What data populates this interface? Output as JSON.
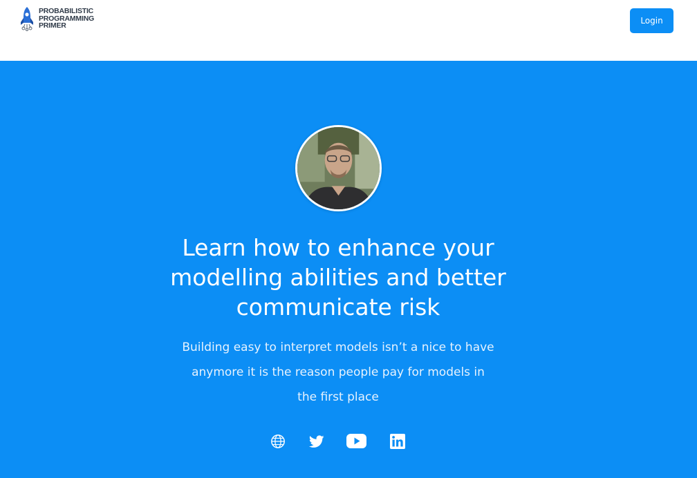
{
  "header": {
    "logo": {
      "line1": "PROBABILISTIC",
      "line2": "PROGRAMMING",
      "line3": "PRIMER",
      "icon": "rocket-icon"
    },
    "login_label": "Login"
  },
  "hero": {
    "avatar_alt": "Instructor photo",
    "headline": "Learn how to enhance your modelling abilities and better communicate risk",
    "subtext": "Building easy to interpret models isn’t a nice to have anymore it is the reason people pay for models in the first place",
    "social": [
      {
        "name": "website",
        "icon": "globe-icon"
      },
      {
        "name": "twitter",
        "icon": "twitter-icon"
      },
      {
        "name": "youtube",
        "icon": "youtube-icon"
      },
      {
        "name": "linkedin",
        "icon": "linkedin-icon"
      }
    ]
  },
  "colors": {
    "brand_blue": "#0c8ef5",
    "header_bg": "#ffffff",
    "text_on_blue": "#ffffff"
  }
}
